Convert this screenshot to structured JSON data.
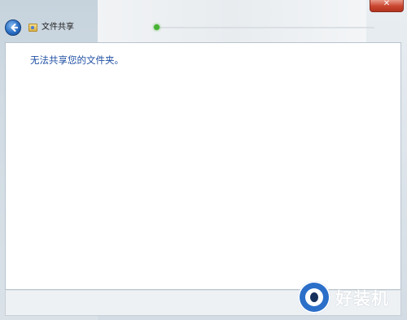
{
  "window": {
    "title": "文件共享",
    "close_glyph": "✕"
  },
  "content": {
    "message": "无法共享您的文件夹。"
  },
  "watermark": {
    "text": "好装机"
  },
  "colors": {
    "message_text": "#1f4fa3",
    "close_button": "#c9452f",
    "back_button": "#2a6fc4",
    "progress_dot": "#46b233"
  },
  "icons": {
    "back": "back-arrow-icon",
    "title": "network-folder-icon",
    "close": "close-icon",
    "watermark": "logo-icon"
  }
}
